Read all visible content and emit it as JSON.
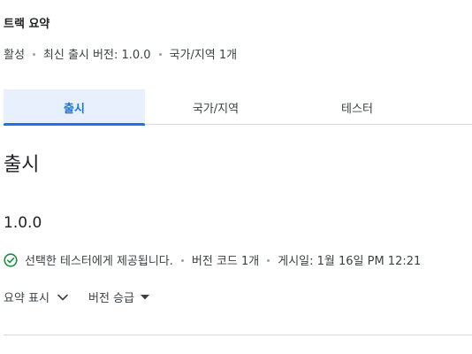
{
  "summary": {
    "title": "트랙 요약",
    "status": "활성",
    "latest_release": "최신 출시 버전: 1.0.0",
    "countries": "국가/지역 1개"
  },
  "tabs": [
    {
      "label": "출시",
      "active": true
    },
    {
      "label": "국가/지역",
      "active": false
    },
    {
      "label": "테스터",
      "active": false
    }
  ],
  "section": {
    "title": "출시"
  },
  "release": {
    "version": "1.0.0",
    "availability": "선택한 테스터에게 제공됩니다.",
    "version_codes": "버전 코드 1개",
    "published": "게시일: 1월 16일 PM 12:21",
    "show_summary_label": "요약 표시",
    "promote_label": "버전 승급"
  },
  "colors": {
    "accent": "#1a73e8",
    "success": "#1e8e3e",
    "active_tab_bg": "#e8f0fe"
  },
  "icons": {
    "status": "check-circle-icon",
    "expand": "chevron-down-icon",
    "dropdown": "caret-down-icon"
  }
}
